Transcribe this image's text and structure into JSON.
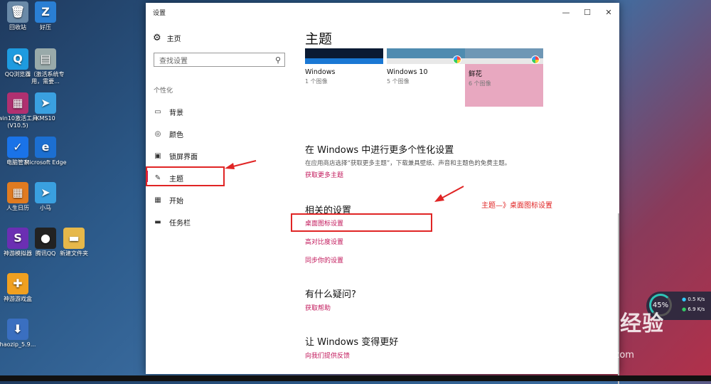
{
  "desktop_icons": [
    {
      "label": "回收站",
      "icon": "recycle-bin-icon",
      "glyph": "🗑",
      "color": "#6a8aa8"
    },
    {
      "label": "好压",
      "icon": "haozip-icon",
      "glyph": "Z",
      "color": "#2a7fd4"
    },
    {
      "label": "QQ浏览器",
      "icon": "qq-browser-icon",
      "glyph": "Q",
      "color": "#1e9be0"
    },
    {
      "label": "1（激活系统专用，需要...",
      "icon": "file-icon",
      "glyph": "▤",
      "color": "#9aa"
    },
    {
      "label": "win10激活工具(V10.5)",
      "icon": "winrar-icon",
      "glyph": "▦",
      "color": "#b03070"
    },
    {
      "label": "KMS10",
      "icon": "kms-icon",
      "glyph": "➤",
      "color": "#3aa0e0"
    },
    {
      "label": "电脑管家",
      "icon": "pc-manager-icon",
      "glyph": "✓",
      "color": "#1a73e8"
    },
    {
      "label": "Microsoft Edge",
      "icon": "edge-icon",
      "glyph": "e",
      "color": "#1c6fd1"
    },
    {
      "label": "人生日历",
      "icon": "calendar-icon",
      "glyph": "▦",
      "color": "#e07b20"
    },
    {
      "label": "小马",
      "icon": "xiaoma-icon",
      "glyph": "➤",
      "color": "#3aa0e0"
    },
    {
      "label": "神游模拟器",
      "icon": "emulator-icon",
      "glyph": "S",
      "color": "#6b2fb3"
    },
    {
      "label": "腾讯QQ",
      "icon": "qq-icon",
      "glyph": "●",
      "color": "#222"
    },
    {
      "label": "新建文件夹",
      "icon": "folder-icon",
      "glyph": "▬",
      "color": "#e6b84a"
    },
    {
      "label": "神游游戏盒",
      "icon": "game-box-icon",
      "glyph": "✚",
      "color": "#f0a020"
    },
    {
      "label": "haozip_5.9...",
      "icon": "haozip-installer-icon",
      "glyph": "⬇",
      "color": "#3a6fc0"
    }
  ],
  "window": {
    "title": "设置",
    "controls": {
      "minimize": "—",
      "maximize": "☐",
      "close": "✕"
    }
  },
  "sidebar": {
    "home": "主页",
    "search_placeholder": "查找设置",
    "section": "个性化",
    "items": [
      {
        "label": "背景",
        "icon": "background-icon",
        "glyph": "▭"
      },
      {
        "label": "颜色",
        "icon": "color-icon",
        "glyph": "◎"
      },
      {
        "label": "锁屏界面",
        "icon": "lock-screen-icon",
        "glyph": "▣"
      },
      {
        "label": "主题",
        "icon": "theme-icon",
        "glyph": "✎"
      },
      {
        "label": "开始",
        "icon": "start-icon",
        "glyph": "▦"
      },
      {
        "label": "任务栏",
        "icon": "taskbar-icon",
        "glyph": "▬"
      }
    ]
  },
  "main": {
    "title": "主题",
    "themes": [
      {
        "name": "Windows",
        "count": "1 个图像",
        "thumb_top": "#0a1a33",
        "thumb_bar": "#1a78d4",
        "selected": false
      },
      {
        "name": "Windows 10",
        "count": "5 个图像",
        "thumb_top": "#4f8bb0",
        "thumb_bar": "#e8e8e8",
        "selected": false
      },
      {
        "name": "鲜花",
        "count": "6 个图像",
        "thumb_top": "#6f97b5",
        "thumb_bar": "#e8e8e8",
        "selected": true
      }
    ],
    "more_heading": "在 Windows 中进行更多个性化设置",
    "more_desc": "在应用商店选择“获取更多主题”，下载兼具壁纸、声音和主题色的免费主题。",
    "more_link": "获取更多主题",
    "related_heading": "相关的设置",
    "related_links": [
      "桌面图标设置",
      "高对比度设置",
      "同步你的设置"
    ],
    "question_heading": "有什么疑问?",
    "question_link": "获取帮助",
    "improve_heading": "让 Windows 变得更好",
    "improve_link": "向我们提供反馈"
  },
  "annotation": "主题—》桌面图标设置",
  "speed_widget": {
    "percent": "45%",
    "up": "0.5",
    "down": "6.9",
    "unit": "K/s"
  },
  "watermark": {
    "brand": "Bai du 经验",
    "url": "jingyan.baidu.com"
  }
}
